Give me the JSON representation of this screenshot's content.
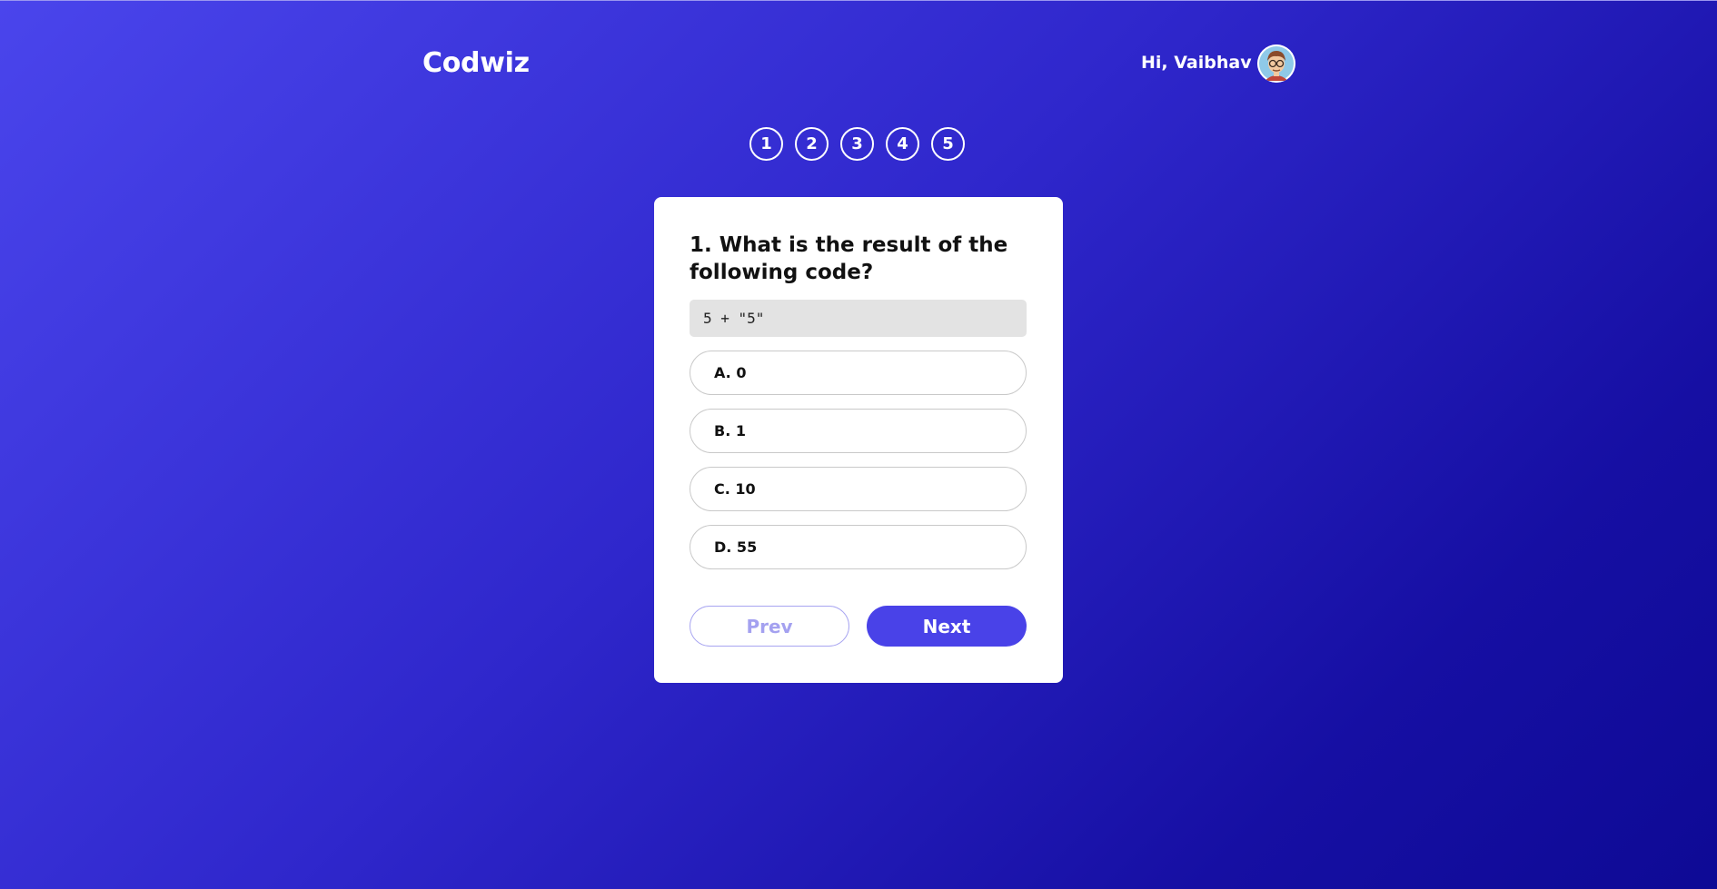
{
  "header": {
    "brand": "Codwiz",
    "greeting": "Hi, Vaibhav",
    "avatar_icon": "user-avatar-icon"
  },
  "steps": [
    "1",
    "2",
    "3",
    "4",
    "5"
  ],
  "quiz": {
    "question": "1. What is the result of the following code?",
    "code": "5 + \"5\"",
    "options": [
      "A. 0",
      "B. 1",
      "C. 10",
      "D. 55"
    ],
    "prev_label": "Prev",
    "next_label": "Next"
  },
  "colors": {
    "accent": "#4942e8",
    "background_start": "#4a45ec",
    "background_end": "#0e0a95"
  }
}
